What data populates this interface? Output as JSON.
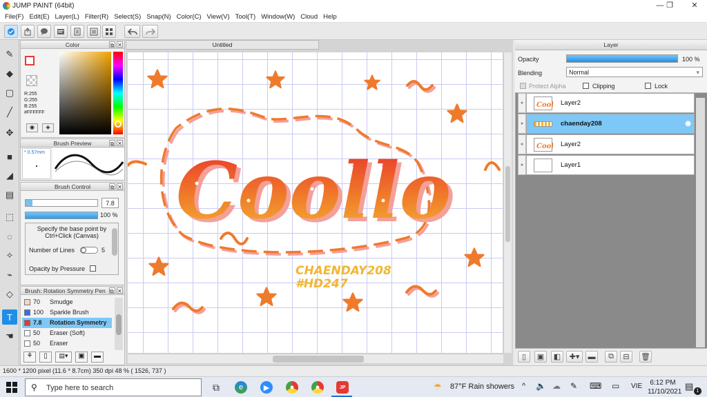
{
  "window": {
    "title": "JUMP PAINT (64bit)",
    "minimize_icon": "—",
    "restore_icon": "❐",
    "close_icon": "✕"
  },
  "menu": [
    "File(F)",
    "Edit(E)",
    "Layer(L)",
    "Filter(R)",
    "Select(S)",
    "Snap(N)",
    "Color(C)",
    "View(V)",
    "Tool(T)",
    "Window(W)",
    "Cloud",
    "Help"
  ],
  "toolbar_icons": [
    "check-icon",
    "export-icon",
    "comment-icon",
    "panel-icon",
    "page-icon",
    "list-icon",
    "grid-icon",
    "undo-icon",
    "redo-icon"
  ],
  "color_panel": {
    "title": "Color",
    "r": "R:255",
    "g": "G:255",
    "b": "B:255",
    "hex": "#FFFFFF"
  },
  "brush_preview": {
    "title": "Brush Preview",
    "size": "* 0.57mm"
  },
  "brush_control": {
    "title": "Brush Control",
    "size_value": "7.8",
    "opacity_value": "100 %",
    "size_fill": 0.1,
    "opacity_fill": 1.0,
    "hint": "Specify the base point by Ctrl+Click (Canvas)",
    "lines_label": "Number of Lines",
    "lines_value": "5",
    "pressure_label": "Opacity by Pressure"
  },
  "brush_list": {
    "title": "Brush: Rotation Symmetry Pen",
    "items": [
      {
        "size": "70",
        "name": "Smudge",
        "color": "#f5d6c8",
        "selected": false
      },
      {
        "size": "100",
        "name": "Sparkle Brush",
        "color": "#3b6fe0",
        "selected": false
      },
      {
        "size": "7.8",
        "name": "Rotation Symmetry",
        "color": "#e53935",
        "selected": true
      },
      {
        "size": "50",
        "name": "Eraser (Soft)",
        "color": "#ffffff",
        "selected": false
      },
      {
        "size": "50",
        "name": "Eraser",
        "color": "#ffffff",
        "selected": false
      }
    ]
  },
  "canvas": {
    "tab": "Untitled",
    "art_text": "Coollo",
    "sub1": "CHAENDAY208",
    "sub2": "#HD247"
  },
  "layer_panel": {
    "title": "Layer",
    "opacity_label": "Opacity",
    "opacity_value": "100 %",
    "opacity_fill": 1.0,
    "blending_label": "Blending",
    "blending_value": "Normal",
    "protect_alpha": "Protect Alpha",
    "clipping": "Clipping",
    "lock": "Lock",
    "layers": [
      {
        "name": "Layer2",
        "selected": false,
        "thumb": "art"
      },
      {
        "name": "chaenday208",
        "selected": true,
        "thumb": "text"
      },
      {
        "name": "Layer2",
        "selected": false,
        "thumb": "art"
      },
      {
        "name": "Layer1",
        "selected": false,
        "thumb": "blank"
      }
    ]
  },
  "status": {
    "text": "1600 * 1200 pixel   (11.6 * 8.7cm)  350 dpi   48 %   ( 1526, 737 )"
  },
  "taskbar": {
    "search_placeholder": "Type here to search",
    "weather": "87°F  Rain showers",
    "lang": "VIE",
    "time": "6:12 PM",
    "date": "11/10/2021",
    "notification_count": "1"
  },
  "colors": {
    "accent": "#1f8ee8",
    "art_orange": "#f07a2a",
    "art_yellow": "#f2b632",
    "art_red": "#e8352c",
    "art_pink": "#f4a09a"
  }
}
